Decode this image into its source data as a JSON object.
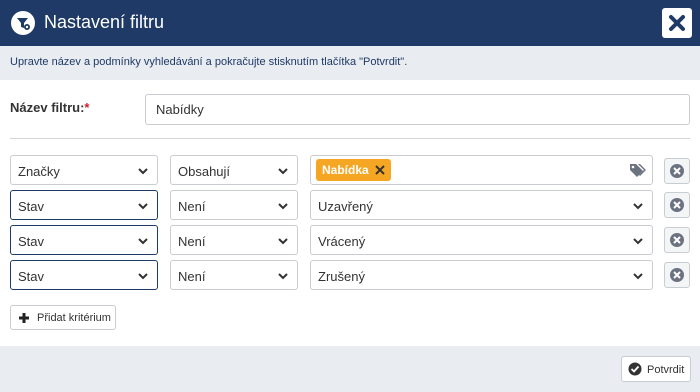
{
  "dialog": {
    "title": "Nastavení filtru",
    "instruction": "Upravte název a podmínky vyhledávání a pokračujte stisknutím tlačítka \"Potvrdit\"."
  },
  "filter_name": {
    "label": "Název filtru:",
    "required_mark": "*",
    "value": "Nabídky"
  },
  "criteria": [
    {
      "field": "Značky",
      "operator": "Obsahují",
      "tag": "Nabídka"
    },
    {
      "field": "Stav",
      "operator": "Není",
      "value": "Uzavřený"
    },
    {
      "field": "Stav",
      "operator": "Není",
      "value": "Vrácený"
    },
    {
      "field": "Stav",
      "operator": "Není",
      "value": "Zrušený"
    }
  ],
  "buttons": {
    "add_criterion": "Přidat kritérium",
    "confirm": "Potvrdit"
  },
  "colors": {
    "header": "#1f3a66",
    "tag": "#f5a623",
    "required": "#d02030"
  },
  "icons": [
    "filter-settings-icon",
    "close-icon",
    "chevron-down-icon",
    "tags-icon",
    "remove-circle-icon",
    "plus-icon",
    "check-circle-icon"
  ]
}
